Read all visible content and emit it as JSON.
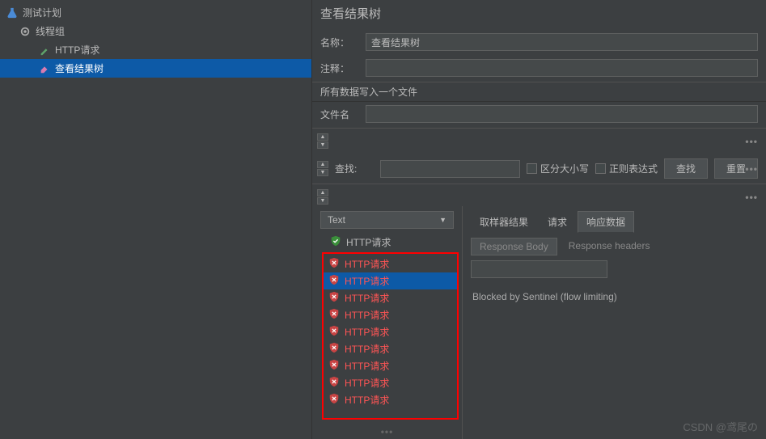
{
  "tree": {
    "root": "测试计划",
    "group": "线程组",
    "http": "HTTP请求",
    "viewer": "查看结果树"
  },
  "panel": {
    "title": "查看结果树",
    "name_label": "名称：",
    "name_value": "查看结果树",
    "comment_label": "注释：",
    "comment_value": "",
    "write_section": "所有数据写入一个文件",
    "filename_label": "文件名",
    "filename_value": "",
    "search_label": "查找:",
    "search_value": "",
    "case_label": "区分大小写",
    "regex_label": "正则表达式",
    "search_btn": "查找",
    "reset_btn": "重置"
  },
  "results": {
    "format_selected": "Text",
    "items": [
      {
        "label": "HTTP请求",
        "status": "ok",
        "selected": false
      },
      {
        "label": "HTTP请求",
        "status": "fail",
        "selected": false
      },
      {
        "label": "HTTP请求",
        "status": "fail",
        "selected": true
      },
      {
        "label": "HTTP请求",
        "status": "fail",
        "selected": false
      },
      {
        "label": "HTTP请求",
        "status": "fail",
        "selected": false
      },
      {
        "label": "HTTP请求",
        "status": "fail",
        "selected": false
      },
      {
        "label": "HTTP请求",
        "status": "fail",
        "selected": false
      },
      {
        "label": "HTTP请求",
        "status": "fail",
        "selected": false
      },
      {
        "label": "HTTP请求",
        "status": "fail",
        "selected": false
      },
      {
        "label": "HTTP请求",
        "status": "fail",
        "selected": false
      }
    ]
  },
  "response": {
    "tabs": [
      "取样器结果",
      "请求",
      "响应数据"
    ],
    "active_tab": 2,
    "subtabs": [
      "Response Body",
      "Response headers"
    ],
    "active_subtab": 0,
    "body": "Blocked by Sentinel (flow limiting)"
  },
  "watermark": "CSDN @鸢尾の"
}
